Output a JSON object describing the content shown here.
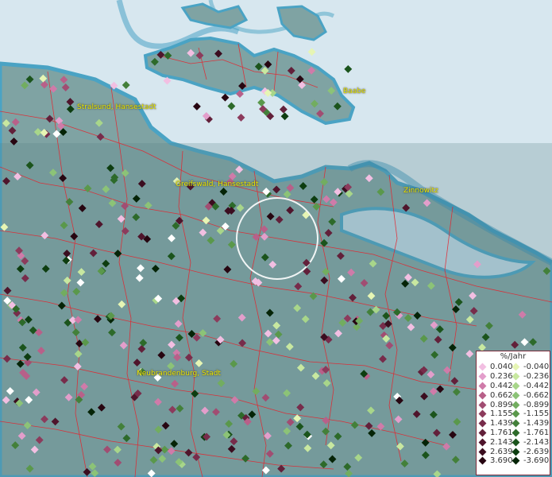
{
  "cities": [
    {
      "name": "Stralsund, Hansestadt"
    },
    {
      "name": "Baabe"
    },
    {
      "name": "Greifswald, Hansestadt"
    },
    {
      "name": "Zinnowitz"
    },
    {
      "name": "Neubrandenburg, Stadt"
    }
  ],
  "legend": {
    "title": "%/Jahr",
    "positive": [
      {
        "label": "0.040",
        "color": "#f2bfe2"
      },
      {
        "label": "0.236",
        "color": "#e39ecb"
      },
      {
        "label": "0.442",
        "color": "#cf7ba9"
      },
      {
        "label": "0.662",
        "color": "#b86089"
      },
      {
        "label": "0.899",
        "color": "#a14d72"
      },
      {
        "label": "1.155",
        "color": "#8c3b5c"
      },
      {
        "label": "1.439",
        "color": "#772c4b"
      },
      {
        "label": "1.761",
        "color": "#62203a"
      },
      {
        "label": "2.143",
        "color": "#4f152c"
      },
      {
        "label": "2.639",
        "color": "#3b0d1f"
      },
      {
        "label": "3.690",
        "color": "#270611"
      }
    ],
    "negative": [
      {
        "label": "-0.040",
        "color": "#e6f5b4"
      },
      {
        "label": "-0.236",
        "color": "#c8e8a0"
      },
      {
        "label": "-0.442",
        "color": "#a8d68a"
      },
      {
        "label": "-0.662",
        "color": "#8cc377"
      },
      {
        "label": "-0.899",
        "color": "#72ad60"
      },
      {
        "label": "-1.155",
        "color": "#5a984b"
      },
      {
        "label": "-1.439",
        "color": "#43803a"
      },
      {
        "label": "-1.761",
        "color": "#2d6a2a"
      },
      {
        "label": "-2.143",
        "color": "#1b541c"
      },
      {
        "label": "-2.639",
        "color": "#0d3d10"
      },
      {
        "label": "-3.690",
        "color": "#052407"
      }
    ]
  },
  "colors": {
    "sea": "#d7e7ef",
    "land": "#7fa3a3",
    "coast": "#4aa3c4",
    "borders": "#e8202a",
    "highlight": "#ffffff",
    "white_point": "#ffffff"
  }
}
